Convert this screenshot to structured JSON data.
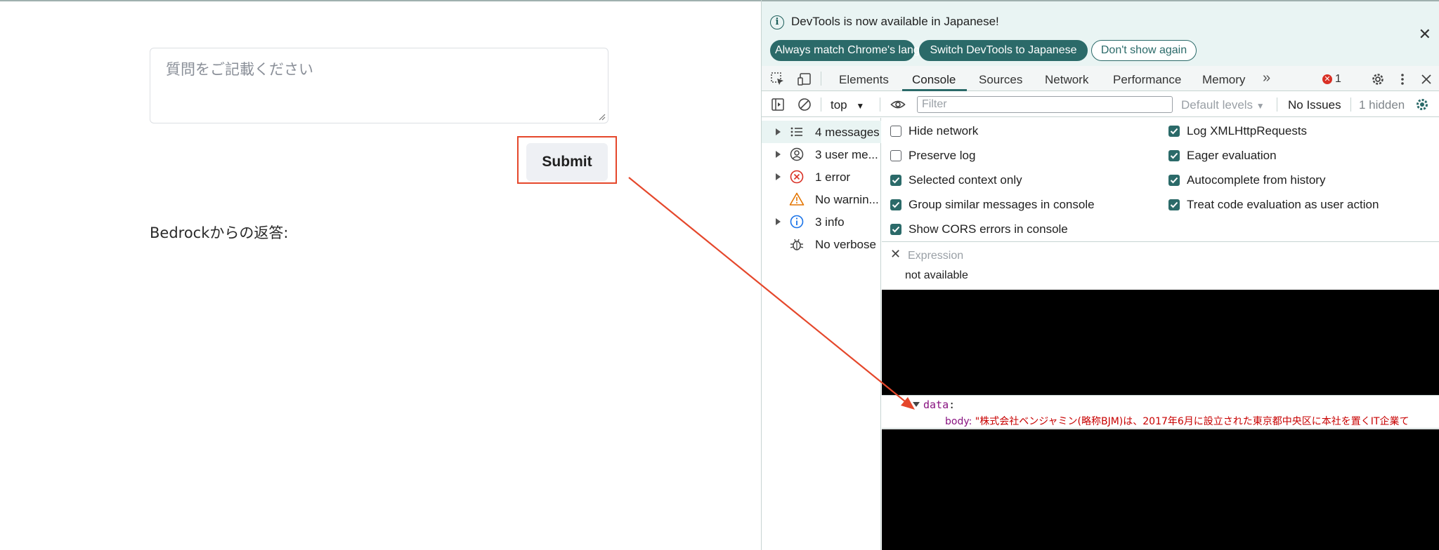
{
  "page": {
    "question_placeholder": "質問をご記載ください",
    "submit_label": "Submit",
    "response_label": "Bedrockからの返答:"
  },
  "devtools": {
    "infobar": {
      "message": "DevTools is now available in Japanese!",
      "btn_match": "Always match Chrome's language",
      "btn_switch": "Switch DevTools to Japanese",
      "btn_dismiss": "Don't show again"
    },
    "tabs": [
      {
        "label": "Elements"
      },
      {
        "label": "Console"
      },
      {
        "label": "Sources"
      },
      {
        "label": "Network"
      },
      {
        "label": "Performance"
      },
      {
        "label": "Memory"
      }
    ],
    "active_tab": "Console",
    "error_count": "1",
    "filterbar": {
      "context": "top",
      "filter_placeholder": "Filter",
      "levels": "Default levels",
      "issues": "No Issues",
      "hidden": "1 hidden"
    },
    "sidebar": [
      {
        "label": "4 messages",
        "icon": "list-icon",
        "expandable": true
      },
      {
        "label": "3 user me...",
        "icon": "user-icon",
        "expandable": true
      },
      {
        "label": "1 error",
        "icon": "error-icon",
        "expandable": true
      },
      {
        "label": "No warnin...",
        "icon": "warning-icon",
        "expandable": false
      },
      {
        "label": "3 info",
        "icon": "info-icon",
        "expandable": true
      },
      {
        "label": "No verbose",
        "icon": "bug-icon",
        "expandable": false
      }
    ],
    "settings": {
      "left": [
        {
          "label": "Hide network",
          "checked": false
        },
        {
          "label": "Preserve log",
          "checked": false
        },
        {
          "label": "Selected context only",
          "checked": true
        },
        {
          "label": "Group similar messages in console",
          "checked": true
        },
        {
          "label": "Show CORS errors in console",
          "checked": true
        }
      ],
      "right": [
        {
          "label": "Log XMLHttpRequests",
          "checked": true
        },
        {
          "label": "Eager evaluation",
          "checked": true
        },
        {
          "label": "Autocomplete from history",
          "checked": true
        },
        {
          "label": "Treat code evaluation as user action",
          "checked": true
        }
      ]
    },
    "expression": {
      "label": "Expression",
      "value": "not available"
    },
    "console_output": {
      "data_key": "data",
      "body_key": "body",
      "body_value": "\"株式会社ベンジャミン(略称BJM)は、2017年6月に設立された東京都中央区に本社を置くIT企業て"
    }
  },
  "colors": {
    "accent": "#2b6a69",
    "highlight": "#e5472b",
    "error": "#d93025"
  }
}
